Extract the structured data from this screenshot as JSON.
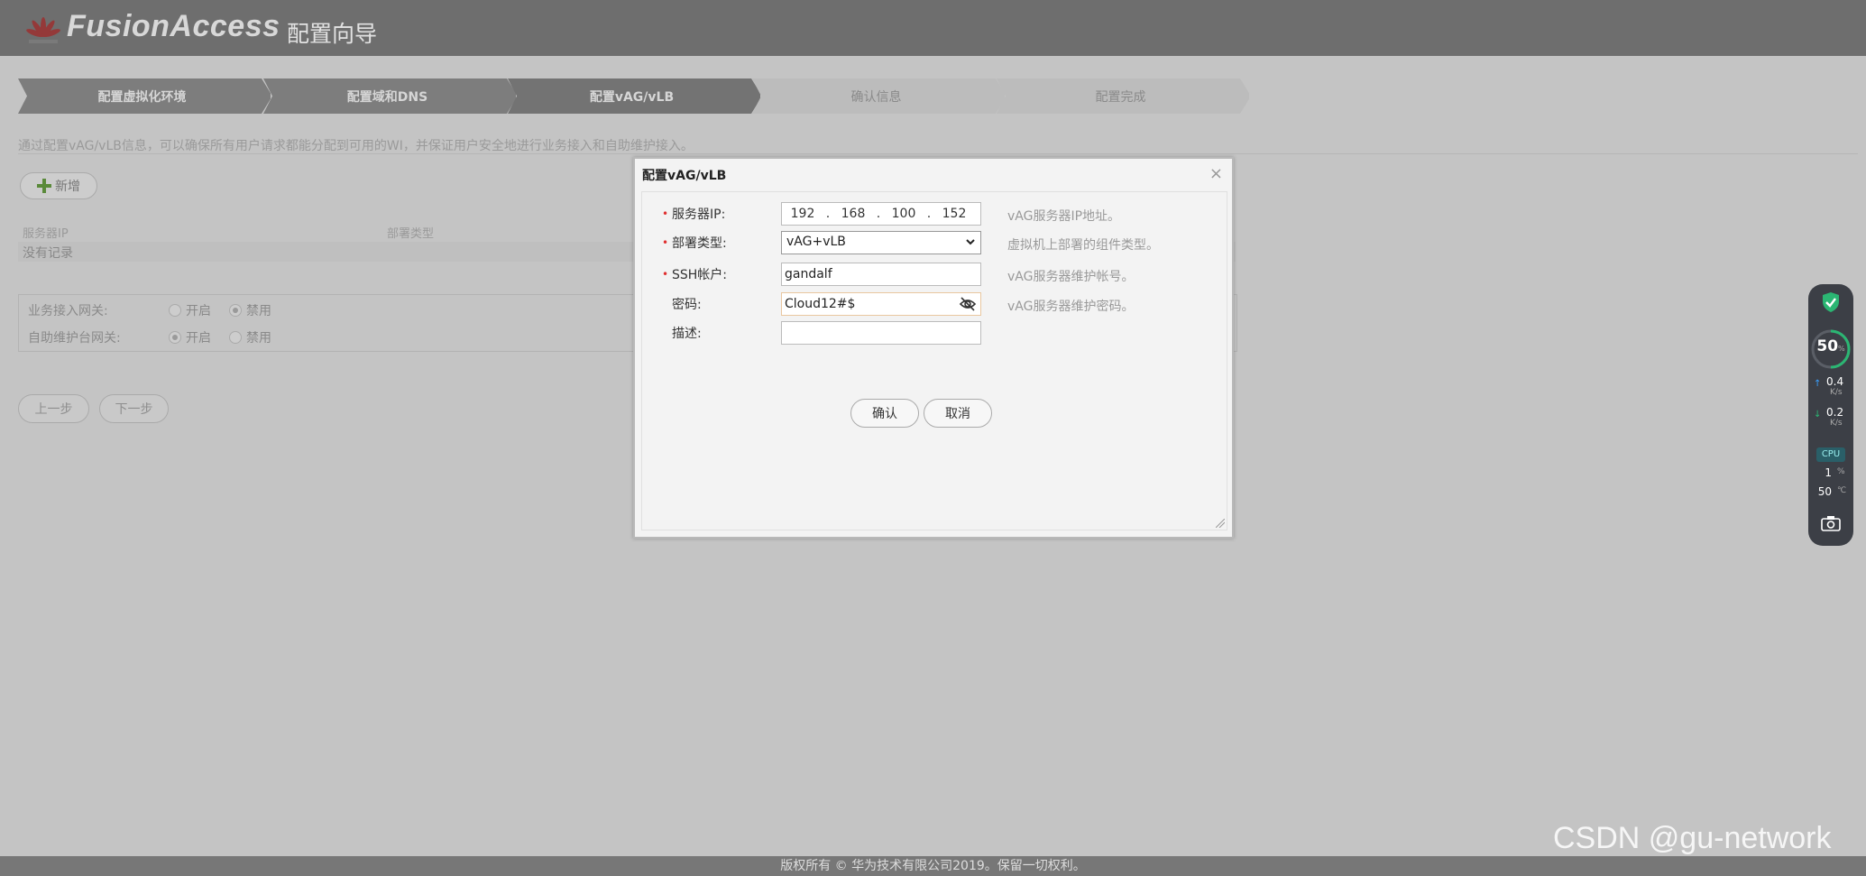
{
  "header": {
    "brand": "FusionAccess",
    "wizard_title": "配置向导"
  },
  "steps": [
    {
      "label": "配置虚拟化环境",
      "state": "done"
    },
    {
      "label": "配置域和DNS",
      "state": "done"
    },
    {
      "label": "配置vAG/vLB",
      "state": "current"
    },
    {
      "label": "确认信息",
      "state": "todo"
    },
    {
      "label": "配置完成",
      "state": "todo"
    }
  ],
  "intro": "通过配置vAG/vLB信息，可以确保所有用户请求都能分配到可用的WI，并保证用户安全地进行业务接入和自助维护接入。",
  "add_button": "新增",
  "table": {
    "columns": [
      "服务器IP",
      "部署类型"
    ],
    "empty_text": "没有记录"
  },
  "gateways": [
    {
      "label": "业务接入网关:",
      "options": [
        "开启",
        "禁用"
      ],
      "selected": "禁用"
    },
    {
      "label": "自助维护台网关:",
      "options": [
        "开启",
        "禁用"
      ],
      "selected": "开启"
    }
  ],
  "nav": {
    "prev": "上一步",
    "next": "下一步"
  },
  "dialog": {
    "title": "配置vAG/vLB",
    "close": "×",
    "fields": {
      "server_ip": {
        "label": "服务器IP:",
        "octets": [
          "192",
          "168",
          "100",
          "152"
        ],
        "hint": "vAG服务器IP地址。",
        "required": true
      },
      "deploy_type": {
        "label": "部署类型:",
        "value": "vAG+vLB",
        "hint": "虚拟机上部署的组件类型。",
        "required": true
      },
      "ssh_account": {
        "label": "SSH帐户:",
        "value": "gandalf",
        "hint": "vAG服务器维护帐号。",
        "required": true
      },
      "password": {
        "label": "密码:",
        "value": "Cloud12#$",
        "hint": "vAG服务器维护密码。",
        "required": false
      },
      "description": {
        "label": "描述:",
        "value": "",
        "required": false
      }
    },
    "confirm": "确认",
    "cancel": "取消"
  },
  "monitor": {
    "percent": "50",
    "percent_unit": "%",
    "upload": "0.4",
    "upload_unit": "K/s",
    "download": "0.2",
    "download_unit": "K/s",
    "cpu_label": "CPU",
    "cpu_usage": "1",
    "cpu_usage_unit": "%",
    "cpu_temp": "50",
    "cpu_temp_unit": "℃"
  },
  "footer": "版权所有 © 华为技术有限公司2019。保留一切权利。",
  "watermark": "CSDN @gu-network"
}
